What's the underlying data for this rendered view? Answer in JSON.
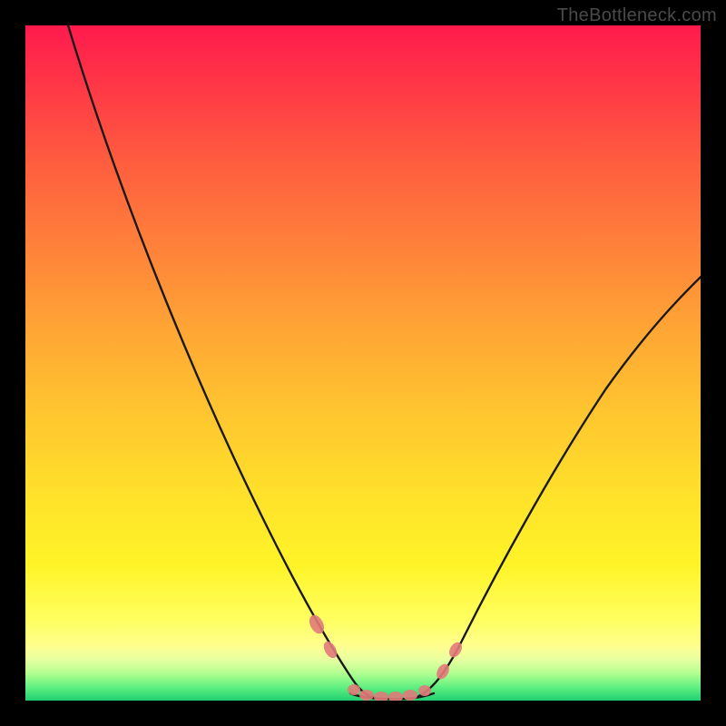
{
  "watermark": "TheBottleneck.com",
  "colors": {
    "background": "#000000",
    "curve": "#1a1a1a",
    "bead": "#e27a7a",
    "gradient_stops": [
      "#ff1a4d",
      "#ff3447",
      "#ff5c3f",
      "#ff823a",
      "#ffa834",
      "#ffc72f",
      "#ffe22a",
      "#fff428",
      "#ffff60",
      "#ffff90",
      "#e6ffa0",
      "#b0ff90",
      "#60f080",
      "#20d070"
    ]
  },
  "chart_data": {
    "type": "line",
    "title": "",
    "xlabel": "",
    "ylabel": "",
    "xlim": [
      0,
      100
    ],
    "ylim": [
      0,
      100
    ],
    "legend": false,
    "grid": false,
    "series": [
      {
        "name": "left-curve",
        "x": [
          6,
          12,
          18,
          24,
          30,
          36,
          40,
          43,
          46,
          48
        ],
        "y": [
          100,
          85,
          70,
          55,
          40,
          25,
          14,
          7,
          3,
          1
        ]
      },
      {
        "name": "right-curve",
        "x": [
          58,
          60,
          63,
          68,
          74,
          82,
          90,
          100
        ],
        "y": [
          1,
          3,
          7,
          15,
          26,
          40,
          52,
          65
        ]
      },
      {
        "name": "valley-floor",
        "x": [
          48,
          50,
          52,
          54,
          56,
          58
        ],
        "y": [
          1,
          0.5,
          0.5,
          0.5,
          0.5,
          1
        ]
      }
    ],
    "annotations": [
      {
        "name": "bead-left-upper",
        "x": 42.5,
        "y": 8
      },
      {
        "name": "bead-left-lower",
        "x": 44.5,
        "y": 5
      },
      {
        "name": "bead-valley-1",
        "x": 48,
        "y": 1
      },
      {
        "name": "bead-valley-2",
        "x": 50,
        "y": 0.6
      },
      {
        "name": "bead-valley-3",
        "x": 52,
        "y": 0.5
      },
      {
        "name": "bead-valley-4",
        "x": 54,
        "y": 0.5
      },
      {
        "name": "bead-valley-5",
        "x": 56,
        "y": 0.6
      },
      {
        "name": "bead-valley-6",
        "x": 58,
        "y": 1
      },
      {
        "name": "bead-right-lower",
        "x": 60.5,
        "y": 4
      },
      {
        "name": "bead-right-upper",
        "x": 62.5,
        "y": 7
      }
    ]
  }
}
